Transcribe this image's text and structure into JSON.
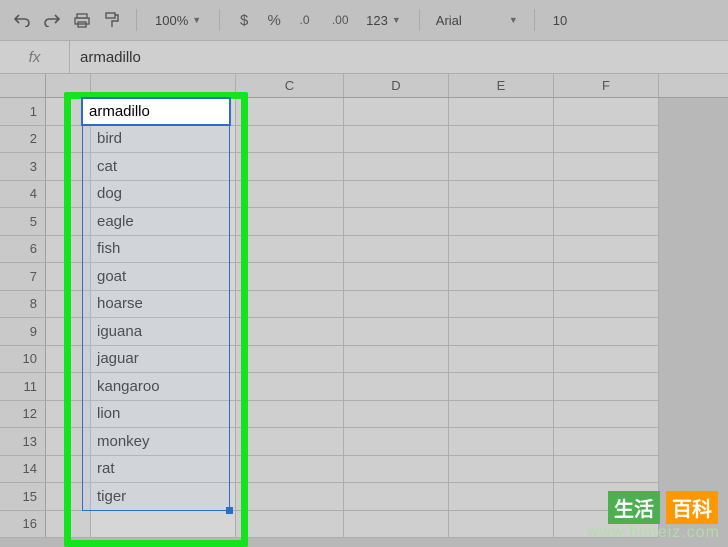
{
  "toolbar": {
    "zoom": "100%",
    "font_name": "Arial",
    "font_size": "10"
  },
  "formula_bar": {
    "fx_label": "fx",
    "value": "armadillo"
  },
  "columns": [
    "",
    "",
    "C",
    "D",
    "E",
    "F"
  ],
  "rows": [
    "1",
    "2",
    "3",
    "4",
    "5",
    "6",
    "7",
    "8",
    "9",
    "10",
    "11",
    "12",
    "13",
    "14",
    "15",
    "16"
  ],
  "cells": {
    "B1": "armadillo",
    "B2": "bird",
    "B3": "cat",
    "B4": "dog",
    "B5": "eagle",
    "B6": "fish",
    "B7": "goat",
    "B8": "hoarse",
    "B9": "iguana",
    "B10": "jaguar",
    "B11": "kangaroo",
    "B12": "lion",
    "B13": "monkey",
    "B14": "rat",
    "B15": "tiger"
  },
  "watermark": {
    "badge1": "生活",
    "badge2": "百科",
    "url": "www.bimeiz.com"
  }
}
